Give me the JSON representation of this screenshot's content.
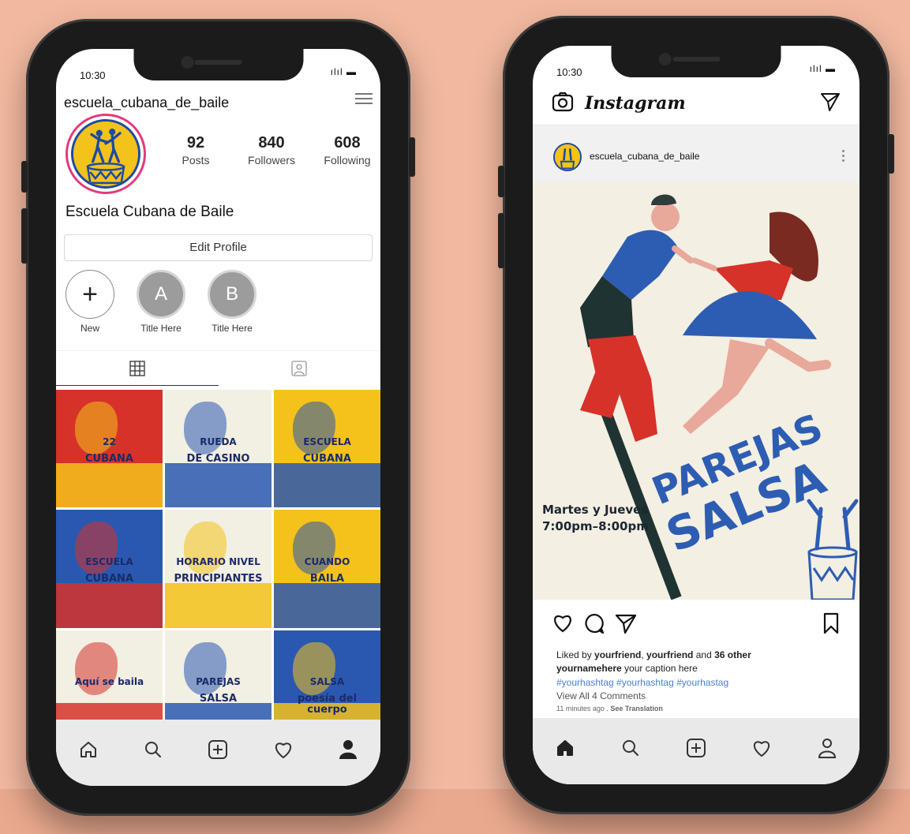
{
  "status": {
    "time_left": "10:30",
    "time_right": "10:30",
    "signal": "ılıl ▬"
  },
  "profile": {
    "username": "escuela_cubana_de_baile",
    "display_name": "Escuela Cubana de Baile",
    "posts": {
      "value": "92",
      "label": "Posts"
    },
    "followers": {
      "value": "840",
      "label": "Followers"
    },
    "following": {
      "value": "608",
      "label": "Following"
    },
    "edit_button": "Edit Profile",
    "highlights": [
      {
        "glyph": "+",
        "label": "New"
      },
      {
        "glyph": "A",
        "label": "Title Here"
      },
      {
        "glyph": "B",
        "label": "Title Here"
      }
    ]
  },
  "grid_posts": [
    {
      "line1": "22",
      "line2": "CUBANA",
      "colors": [
        "#d6322a",
        "#f4c21a"
      ]
    },
    {
      "line1": "RUEDA",
      "line2": "DE CASINO",
      "colors": [
        "#f2efe3",
        "#2a58b0"
      ]
    },
    {
      "line1": "ESCUELA",
      "line2": "CUBANA",
      "colors": [
        "#f4c21a",
        "#2a58b0"
      ]
    },
    {
      "line1": "ESCUELA",
      "line2": "CUBANA",
      "colors": [
        "#2a58b0",
        "#d6322a"
      ]
    },
    {
      "line1": "HORARIO NIVEL",
      "line2": "PRINCIPIANTES",
      "colors": [
        "#f2efe3",
        "#f4c21a"
      ]
    },
    {
      "line1": "CUANDO",
      "line2": "BAILA",
      "colors": [
        "#f4c21a",
        "#2a58b0"
      ]
    },
    {
      "line1": "Aquí se baila",
      "line2": "",
      "colors": [
        "#f2efe3",
        "#d6322a"
      ]
    },
    {
      "line1": "PAREJAS",
      "line2": "SALSA",
      "colors": [
        "#f2efe3",
        "#2a58b0"
      ]
    },
    {
      "line1": "SALSA",
      "line2": "poesía del cuerpo",
      "colors": [
        "#2a58b0",
        "#f4c21a"
      ]
    }
  ],
  "feed": {
    "app_title": "Instagram",
    "post_user": "escuela_cubana_de_baile",
    "headline_1": "PAREJAS",
    "headline_2": "SALSA",
    "schedule_line1": "Martes y Jueves",
    "schedule_line2": "7:00pm–8:00pm",
    "liked_prefix": "Liked by ",
    "liked_friend1": "yourfriend",
    "liked_sep": ", ",
    "liked_friend2": "yourfriend",
    "liked_and": " and ",
    "liked_others": "36 other",
    "caption_user": "yournamehere",
    "caption_text": " your caption here",
    "hashtags": "#yourhashtag #yourhashtag #yourhastag",
    "view_comments": "View All 4 Comments",
    "time_ago": "11 minutes ago",
    "see_translation": "See Translation"
  },
  "colors": {
    "yellow": "#f4c21a",
    "blue": "#2a58b0",
    "red": "#d6322a",
    "cream": "#f3efe2",
    "ring": "#e23a7a",
    "link": "#4a7fd1"
  },
  "icons": {
    "left_nav": [
      "home-icon",
      "search-icon",
      "add-icon",
      "heart-icon",
      "profile-icon"
    ],
    "right_nav": [
      "home-icon",
      "search-icon",
      "add-icon",
      "heart-icon",
      "profile-icon"
    ]
  }
}
